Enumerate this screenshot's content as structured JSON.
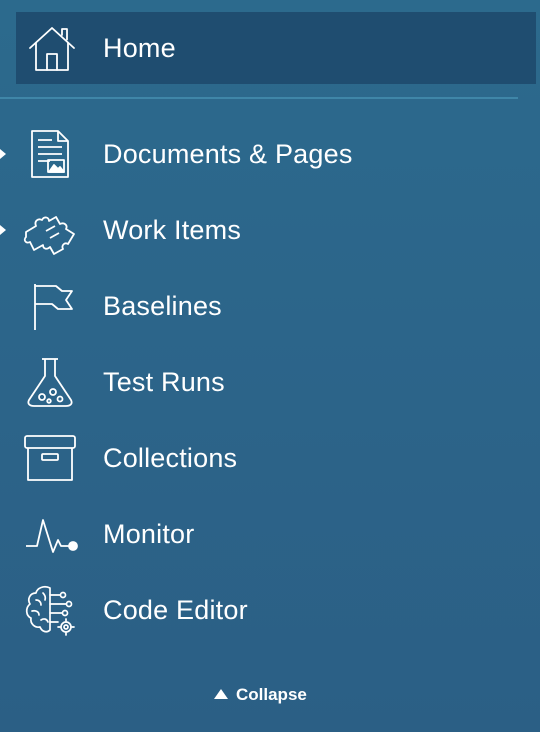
{
  "colors": {
    "background": "#2c658a",
    "home_highlight": "#1f4d70",
    "divider": "#3f86a8",
    "text": "#ffffff"
  },
  "home": {
    "label": "Home",
    "icon": "home-icon"
  },
  "items": [
    {
      "label": "Documents & Pages",
      "icon": "document-icon",
      "expandable": true
    },
    {
      "label": "Work Items",
      "icon": "puzzle-icon",
      "expandable": true
    },
    {
      "label": "Baselines",
      "icon": "flag-icon",
      "expandable": false
    },
    {
      "label": "Test Runs",
      "icon": "flask-icon",
      "expandable": false
    },
    {
      "label": "Collections",
      "icon": "archive-box-icon",
      "expandable": false
    },
    {
      "label": "Monitor",
      "icon": "pulse-icon",
      "expandable": false
    },
    {
      "label": "Code Editor",
      "icon": "brain-circuit-icon",
      "expandable": false
    }
  ],
  "footer": {
    "collapse_label": "Collapse"
  }
}
